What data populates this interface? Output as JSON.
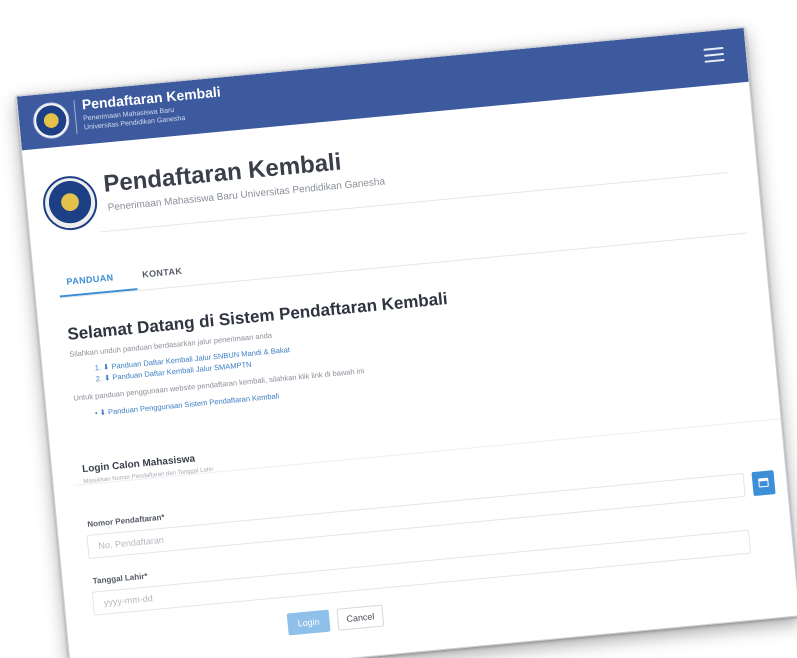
{
  "navbar": {
    "title": "Pendaftaran Kembali",
    "subtitle_line1": "Penerimaan Mahasiswa Baru",
    "subtitle_line2": "Universitas Pendidikan Ganesha"
  },
  "header": {
    "title": "Pendaftaran Kembali",
    "subtitle": "Penerimaan Mahasiswa Baru Universitas Pendidikan Ganesha"
  },
  "tabs": [
    {
      "label": "PANDUAN",
      "active": true
    },
    {
      "label": "KONTAK",
      "active": false
    }
  ],
  "welcome": {
    "title": "Selamat Datang di Sistem Pendaftaran Kembali",
    "description": "Silahkan unduh panduan berdasarkan jalur penerimaan anda",
    "guides": [
      "1. ⬇ Panduan Daftar Kembali Jalur SNBUN Mandi & Bakat",
      "2. ⬇ Panduan Daftar Kembali Jalur SMAMPTN"
    ],
    "usage_text": "Untuk panduan penggunaan website pendaftaran kembali, silahkan klik link di bawah ini",
    "usage_link": "• ⬇ Panduan Penggunaan Sistem Pendaftaran Kembali"
  },
  "login": {
    "title": "Login Calon Mahasiswa",
    "subtitle": "Masukkan Nomor Pendaftaran dan Tanggal Lahir",
    "nomor_label": "Nomor Pendaftaran*",
    "nomor_placeholder": "No. Pendaftaran",
    "tanggal_label": "Tanggal Lahir*",
    "tanggal_placeholder": "yyyy-mm-dd",
    "login_button": "Login",
    "cancel_button": "Cancel"
  },
  "colors": {
    "navbar": "#3d5a9e",
    "accent": "#3b8ed6",
    "login_button": "#8ec0ea"
  },
  "icons": [
    "university-logo",
    "hamburger-menu-icon",
    "download-icon",
    "calendar-icon"
  ]
}
